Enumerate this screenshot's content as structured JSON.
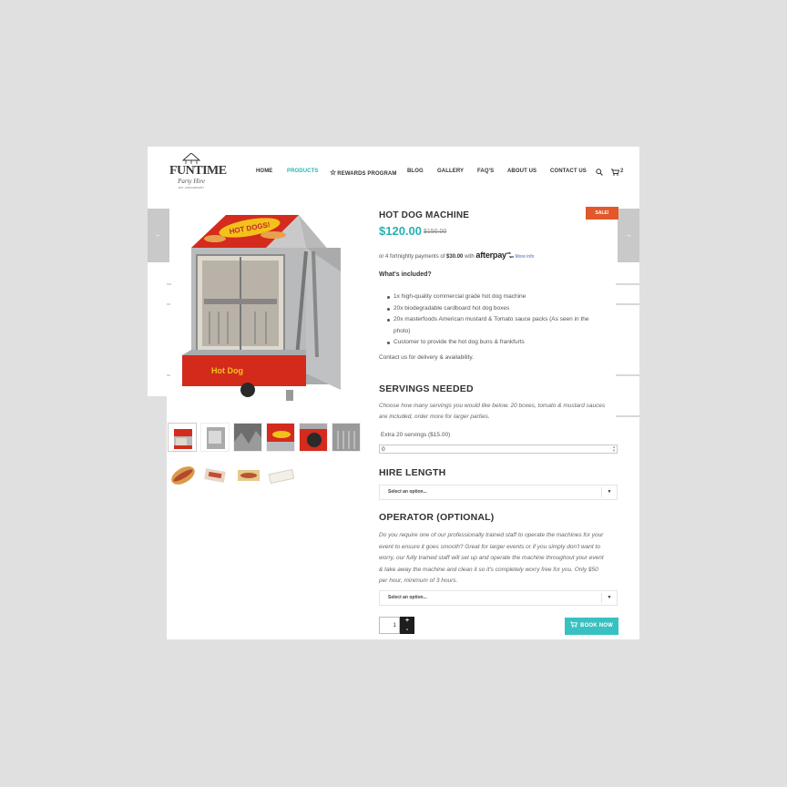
{
  "header": {
    "logo_brand": "FUNTIME",
    "logo_sub": "Party Hire",
    "logo_tiny": "EST. ANNIVERSARY",
    "nav": [
      {
        "label": "HOME"
      },
      {
        "label": "PRODUCTS",
        "active": true
      },
      {
        "label": "REWARDS PROGRAM"
      },
      {
        "label": "BLOG"
      },
      {
        "label": "GALLERY"
      },
      {
        "label": "FAQ'S"
      },
      {
        "label": "ABOUT US"
      },
      {
        "label": "CONTACT US"
      }
    ],
    "cart_count": "2",
    "icons": [
      "search-icon",
      "cart-icon",
      "star-icon"
    ]
  },
  "product": {
    "title": "HOT DOG MACHINE",
    "sale_badge": "SALE!",
    "price": "$120.00",
    "old_price": "$150.00",
    "afterpay_prefix": "or 4 fortnightly payments of",
    "afterpay_amount": "$30.00",
    "afterpay_with": "with",
    "afterpay_logo": "afterpay",
    "afterpay_more": "More info",
    "whats_included": "What's included?",
    "included": [
      "1x high-quality commercial grade hot dog machine",
      "20x biodegradable cardboard hot dog boxes",
      "20x masterfoods American mustard & Tomato sauce packs (As seen in the",
      "photo)",
      "Customer to provide the hot dog buns & frankfurts"
    ],
    "contact": "Contact us for delivery & availability.",
    "image_sign_1": "HOT DOGS!",
    "image_sign_2": "Hot Dog"
  },
  "servings": {
    "heading": "SERVINGS NEEDED",
    "desc_lines": [
      "Choose how many servings you would like below. 20 boxes, tomato & mustard sauces",
      "are included, order more for larger parties."
    ],
    "field_label": "Extra 20 servings ($15.00)",
    "field_value": "0"
  },
  "hire": {
    "heading": "HIRE LENGTH",
    "select_value": "Select an option..."
  },
  "operator": {
    "heading": "OPERATOR (OPTIONAL)",
    "desc_lines": [
      "Do you require one of our professionally trained staff to operate the machines for your",
      "event to ensure it goes smooth? Great for larger events or if you simply don't want to",
      "worry, our fully trained staff will set up and operate the machine throughout your event",
      "& take away the machine and clean it so it's completely worry free for you. Only $50",
      "per hour, minimum of 3 hours."
    ],
    "select_value": "Select an option..."
  },
  "cart": {
    "quantity": "1",
    "plus": "+",
    "minus": "-",
    "book_label": "BOOK NOW"
  },
  "colors": {
    "accent": "#28b5b5",
    "sale": "#e2582a",
    "button": "#38c1c0",
    "background": "#dfe0df"
  }
}
